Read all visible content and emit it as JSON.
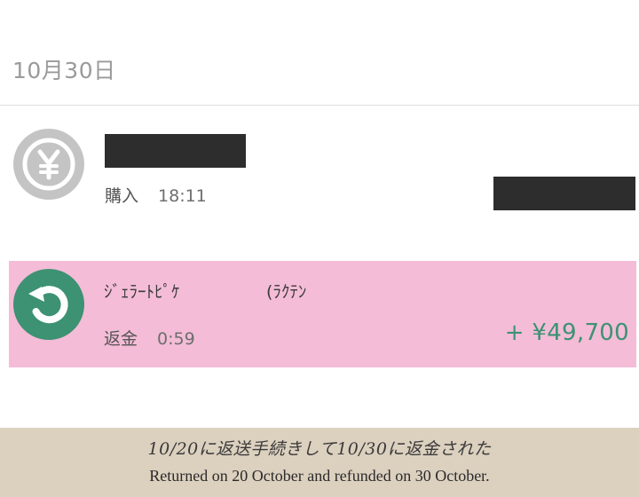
{
  "date_header": "10月30日",
  "transactions": [
    {
      "icon": "yen-coin-icon",
      "merchant": "",
      "type": "購入",
      "time": "18:11",
      "amount": "",
      "icon_color": "#c4c4c4"
    },
    {
      "icon": "refund-arrow-icon",
      "merchant": "ｼﾞｪﾗｰﾄﾋﾟｹ",
      "merchant_extra": "(ﾗｸﾃﾝ",
      "type": "返金",
      "time": "0:59",
      "amount": "+ ¥49,700",
      "icon_color": "#3c9273",
      "highlight_color": "#f4bcd7"
    }
  ],
  "caption": {
    "japanese": "10/20に返送手続きして10/30に返金された",
    "english": "Returned on 20 October and refunded on 30 October."
  }
}
